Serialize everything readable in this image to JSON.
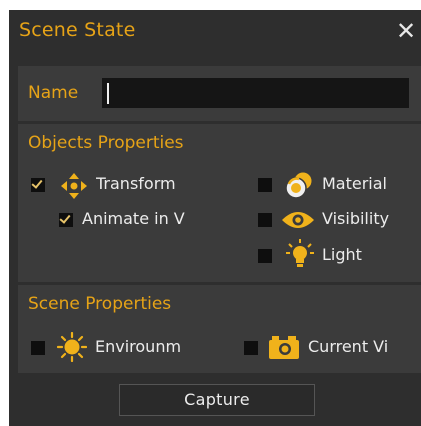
{
  "dialog": {
    "title": "Scene State",
    "close_label": "✕"
  },
  "name_section": {
    "label": "Name",
    "value": "",
    "placeholder": ""
  },
  "objects_section": {
    "title": "Objects Properties",
    "options": [
      {
        "label": "Transform",
        "checked": true,
        "icon": "move-arrows-icon"
      },
      {
        "label": "Animate in V",
        "checked": true,
        "icon": ""
      },
      {
        "label": "Material",
        "checked": false,
        "icon": "material-spheres-icon"
      },
      {
        "label": "Visibility",
        "checked": false,
        "icon": "eye-icon"
      },
      {
        "label": "Light",
        "checked": false,
        "icon": "light-bulb-icon"
      }
    ]
  },
  "scene_section": {
    "title": "Scene Properties",
    "options": [
      {
        "label": "Envirounm",
        "checked": false,
        "icon": "sun-icon"
      },
      {
        "label": "Current Vi",
        "checked": false,
        "icon": "camera-icon"
      }
    ]
  },
  "footer": {
    "capture_label": "Capture"
  },
  "colors": {
    "accent": "#e6a317",
    "panel_bg": "#2e2e2e",
    "section_bg": "#3b3b3b",
    "input_bg": "#151515",
    "text": "#ececec"
  }
}
